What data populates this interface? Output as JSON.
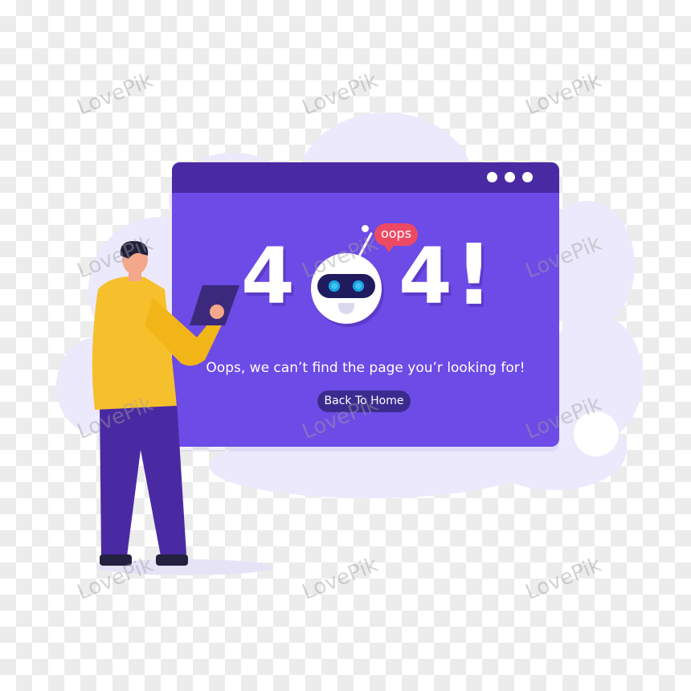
{
  "error": {
    "digit_left": "4",
    "digit_right": "4",
    "exclamation": "!",
    "bubble": "oops",
    "message": "Oops, we can’t find the page you’r looking for!",
    "button_label": "Back To Home"
  },
  "watermark": {
    "text": "LovePik"
  },
  "colors": {
    "window": "#6d4be6",
    "window_bar": "#4a2aa3",
    "button": "#3c2b8f",
    "bubble": "#ec4a63",
    "shirt": "#f6c02c",
    "pants": "#4a2aa3"
  }
}
